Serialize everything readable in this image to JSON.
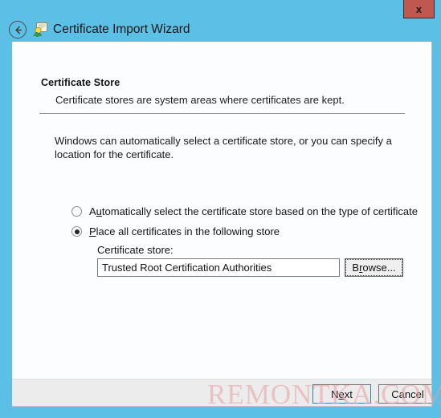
{
  "window": {
    "title": "Certificate Import Wizard",
    "close_label": "x",
    "back_icon": "back-arrow-icon",
    "title_icon": "certificate-icon",
    "titlebar_color": "#5cc0e6",
    "close_button_color": "#c0584f"
  },
  "page": {
    "heading": "Certificate Store",
    "subheading": "Certificate stores are system areas where certificates are kept.",
    "intro": "Windows can automatically select a certificate store, or you can specify a location for the certificate."
  },
  "options": {
    "selected": "place",
    "items": [
      {
        "id": "auto",
        "label_before": "A",
        "label_accel": "u",
        "label_after": "tomatically select the certificate store based on the type of certificate",
        "checked": false
      },
      {
        "id": "place",
        "label_before": "",
        "label_accel": "P",
        "label_after": "lace all certificates in the following store",
        "checked": true
      }
    ]
  },
  "store": {
    "label": "Certificate store:",
    "value": "Trusted Root Certification Authorities",
    "placeholder": "",
    "browse_before": "B",
    "browse_accel": "r",
    "browse_after": "owse..."
  },
  "footer": {
    "next_before": "N",
    "next_accel": "e",
    "next_after": "xt",
    "cancel_label": "Cancel",
    "next_border_color": "#2a7fbd"
  },
  "watermark": {
    "text": "REMONTKA.COM",
    "color": "#e5a0a0"
  }
}
